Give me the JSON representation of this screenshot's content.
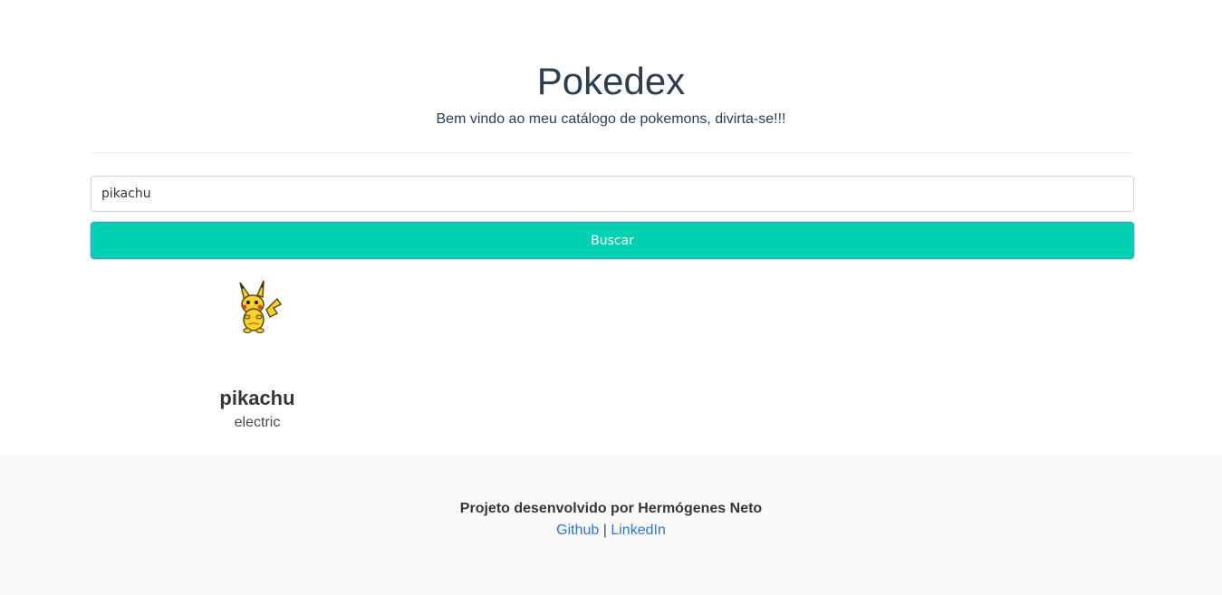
{
  "header": {
    "title": "Pokedex",
    "subtitle": "Bem vindo ao meu catálogo de pokemons, divirta-se!!!"
  },
  "search": {
    "value": "pikachu",
    "placeholder": "",
    "button_label": "Buscar",
    "button_color": "#00d1b2"
  },
  "result": {
    "name": "pikachu",
    "type": "electric",
    "sprite_icon": "pikachu-sprite-icon"
  },
  "footer": {
    "credit": "Projeto desenvolvido por Hermógenes Neto",
    "github_label": "Github",
    "separator": "|",
    "linkedin_label": "LinkedIn",
    "link_color": "#3273dc"
  }
}
